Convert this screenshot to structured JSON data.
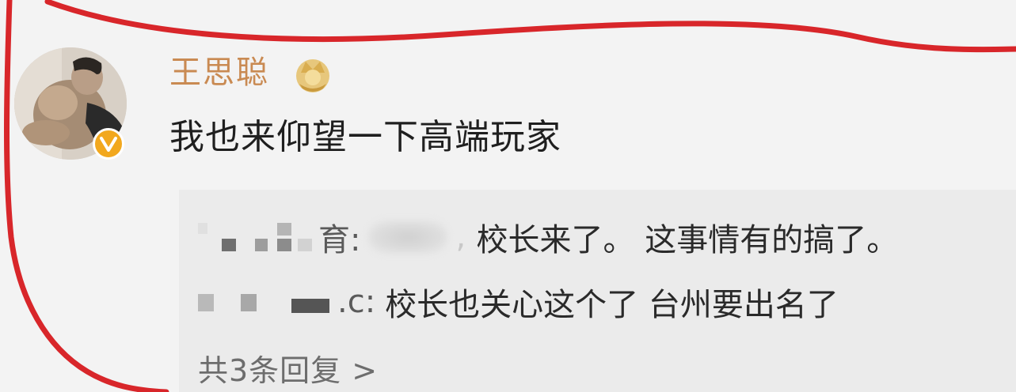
{
  "post": {
    "username": "王思聪",
    "comment": "我也来仰望一下高端玩家",
    "crown_icon": "crown-badge-icon",
    "verified_icon": "verified-v-icon"
  },
  "replies": [
    {
      "author_suffix": "育:",
      "text": "校长来了。 这事情有的搞了。"
    },
    {
      "author_suffix": ".c:",
      "text": "校长也关心这个了 台州要出名了"
    }
  ],
  "total_replies_label": "共3条回复 >",
  "colors": {
    "username": "#c98a52",
    "annotation": "#d8262a",
    "badge": "#f2a81e"
  }
}
